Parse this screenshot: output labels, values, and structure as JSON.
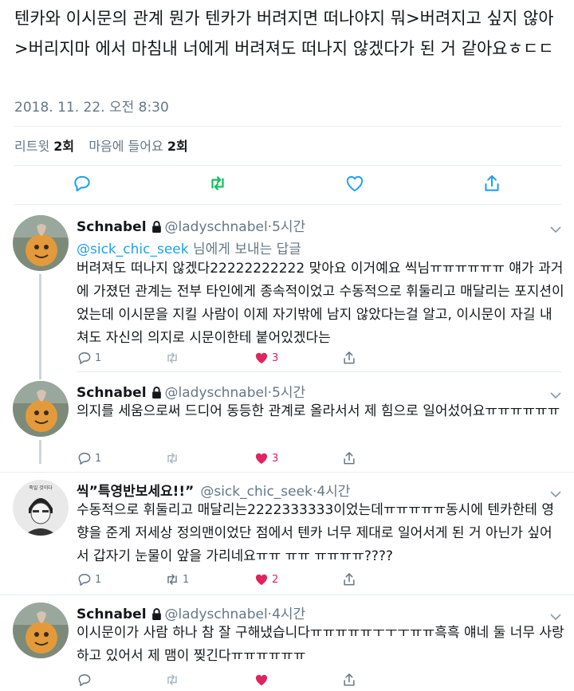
{
  "main_tweet": {
    "text": "텐카와 이시문의 관계 뭔가 텐카가 버려지면 떠나야지 뭐>버려지고 싶지 않아>버리지마 에서 마침내 너에게 버려져도 떠나지 않겠다가 된 거 같아요ㅎㄷㄷ",
    "timestamp": "2018. 11. 22. 오전 8:30",
    "retweets_label": "리트윗",
    "retweets_count": "2회",
    "likes_label": "마음에 들어요",
    "likes_count": "2회"
  },
  "colors": {
    "accent": "#1da1f2",
    "retweet_green": "#17bf63",
    "like_red": "#e0245e",
    "secondary_text": "#657786",
    "divider": "#e6ecf0"
  },
  "replies": [
    {
      "name": "Schnabel",
      "handle": "@ladyschnabel",
      "time": "·5시간",
      "replying_handle": "@sick_chic_seek",
      "replying_suffix": " 님에게 보내는 답글",
      "text": "버려져도 떠나지 않겠다22222222222 맞아요 이거예요 씩님ㅠㅠㅠㅠㅠㅠ 얘가 과거에 가졌던 관계는 전부 타인에게 종속적이었고 수동적으로 휘둘리고 매달리는 포지션이었는데 이시문을 지킬 사람이 이제 자기밖에 남지 않았다는걸 알고, 이시문이 자길 내쳐도 자신의 의지로 시문이한테 붙어있겠다는",
      "reply_count": "1",
      "retweet_count": "",
      "like_count": "3"
    },
    {
      "name": "Schnabel",
      "handle": "@ladyschnabel",
      "time": "·5시간",
      "text": "의지를 세움으로써 드디어 동등한 관계로 올라서서 제 힘으로 일어섰어요ㅠㅠㅠㅠㅠㅠ",
      "reply_count": "1",
      "retweet_count": "",
      "like_count": "3"
    },
    {
      "name": "씩”특영반보세요!!”",
      "handle": "@sick_chic_seek",
      "time": "·4시간",
      "avatar_caption": "죽일 것이다",
      "text": "수동적으로 휘둘리고 매달리는2222333333이었는데ㅠㅠㅠㅠㅠ동시에 텐카한테 영향을 준게 저세상 정의맨이었단 점에서 텐카 너무 제대로 일어서게 된 거 아닌가 싶어서 갑자기 눈물이 앞을 가리네요ㅠㅠ ㅠㅠ ㅠㅠㅠㅠ????",
      "reply_count": "1",
      "retweet_count": "1",
      "like_count": "2"
    },
    {
      "name": "Schnabel",
      "handle": "@ladyschnabel",
      "time": "·4시간",
      "text": "이시문이가 사람 하나 참 잘 구해냈습니다ㅠㅠㅠㅠㅠㅜㅜㅜㅠㅠ흑흑 얘네 둘 너무 사랑하고 있어서 제 맴이 찢긴다ㅠㅠㅠㅠㅠㅠ",
      "reply_count": "",
      "retweet_count": "",
      "like_count": ""
    }
  ]
}
